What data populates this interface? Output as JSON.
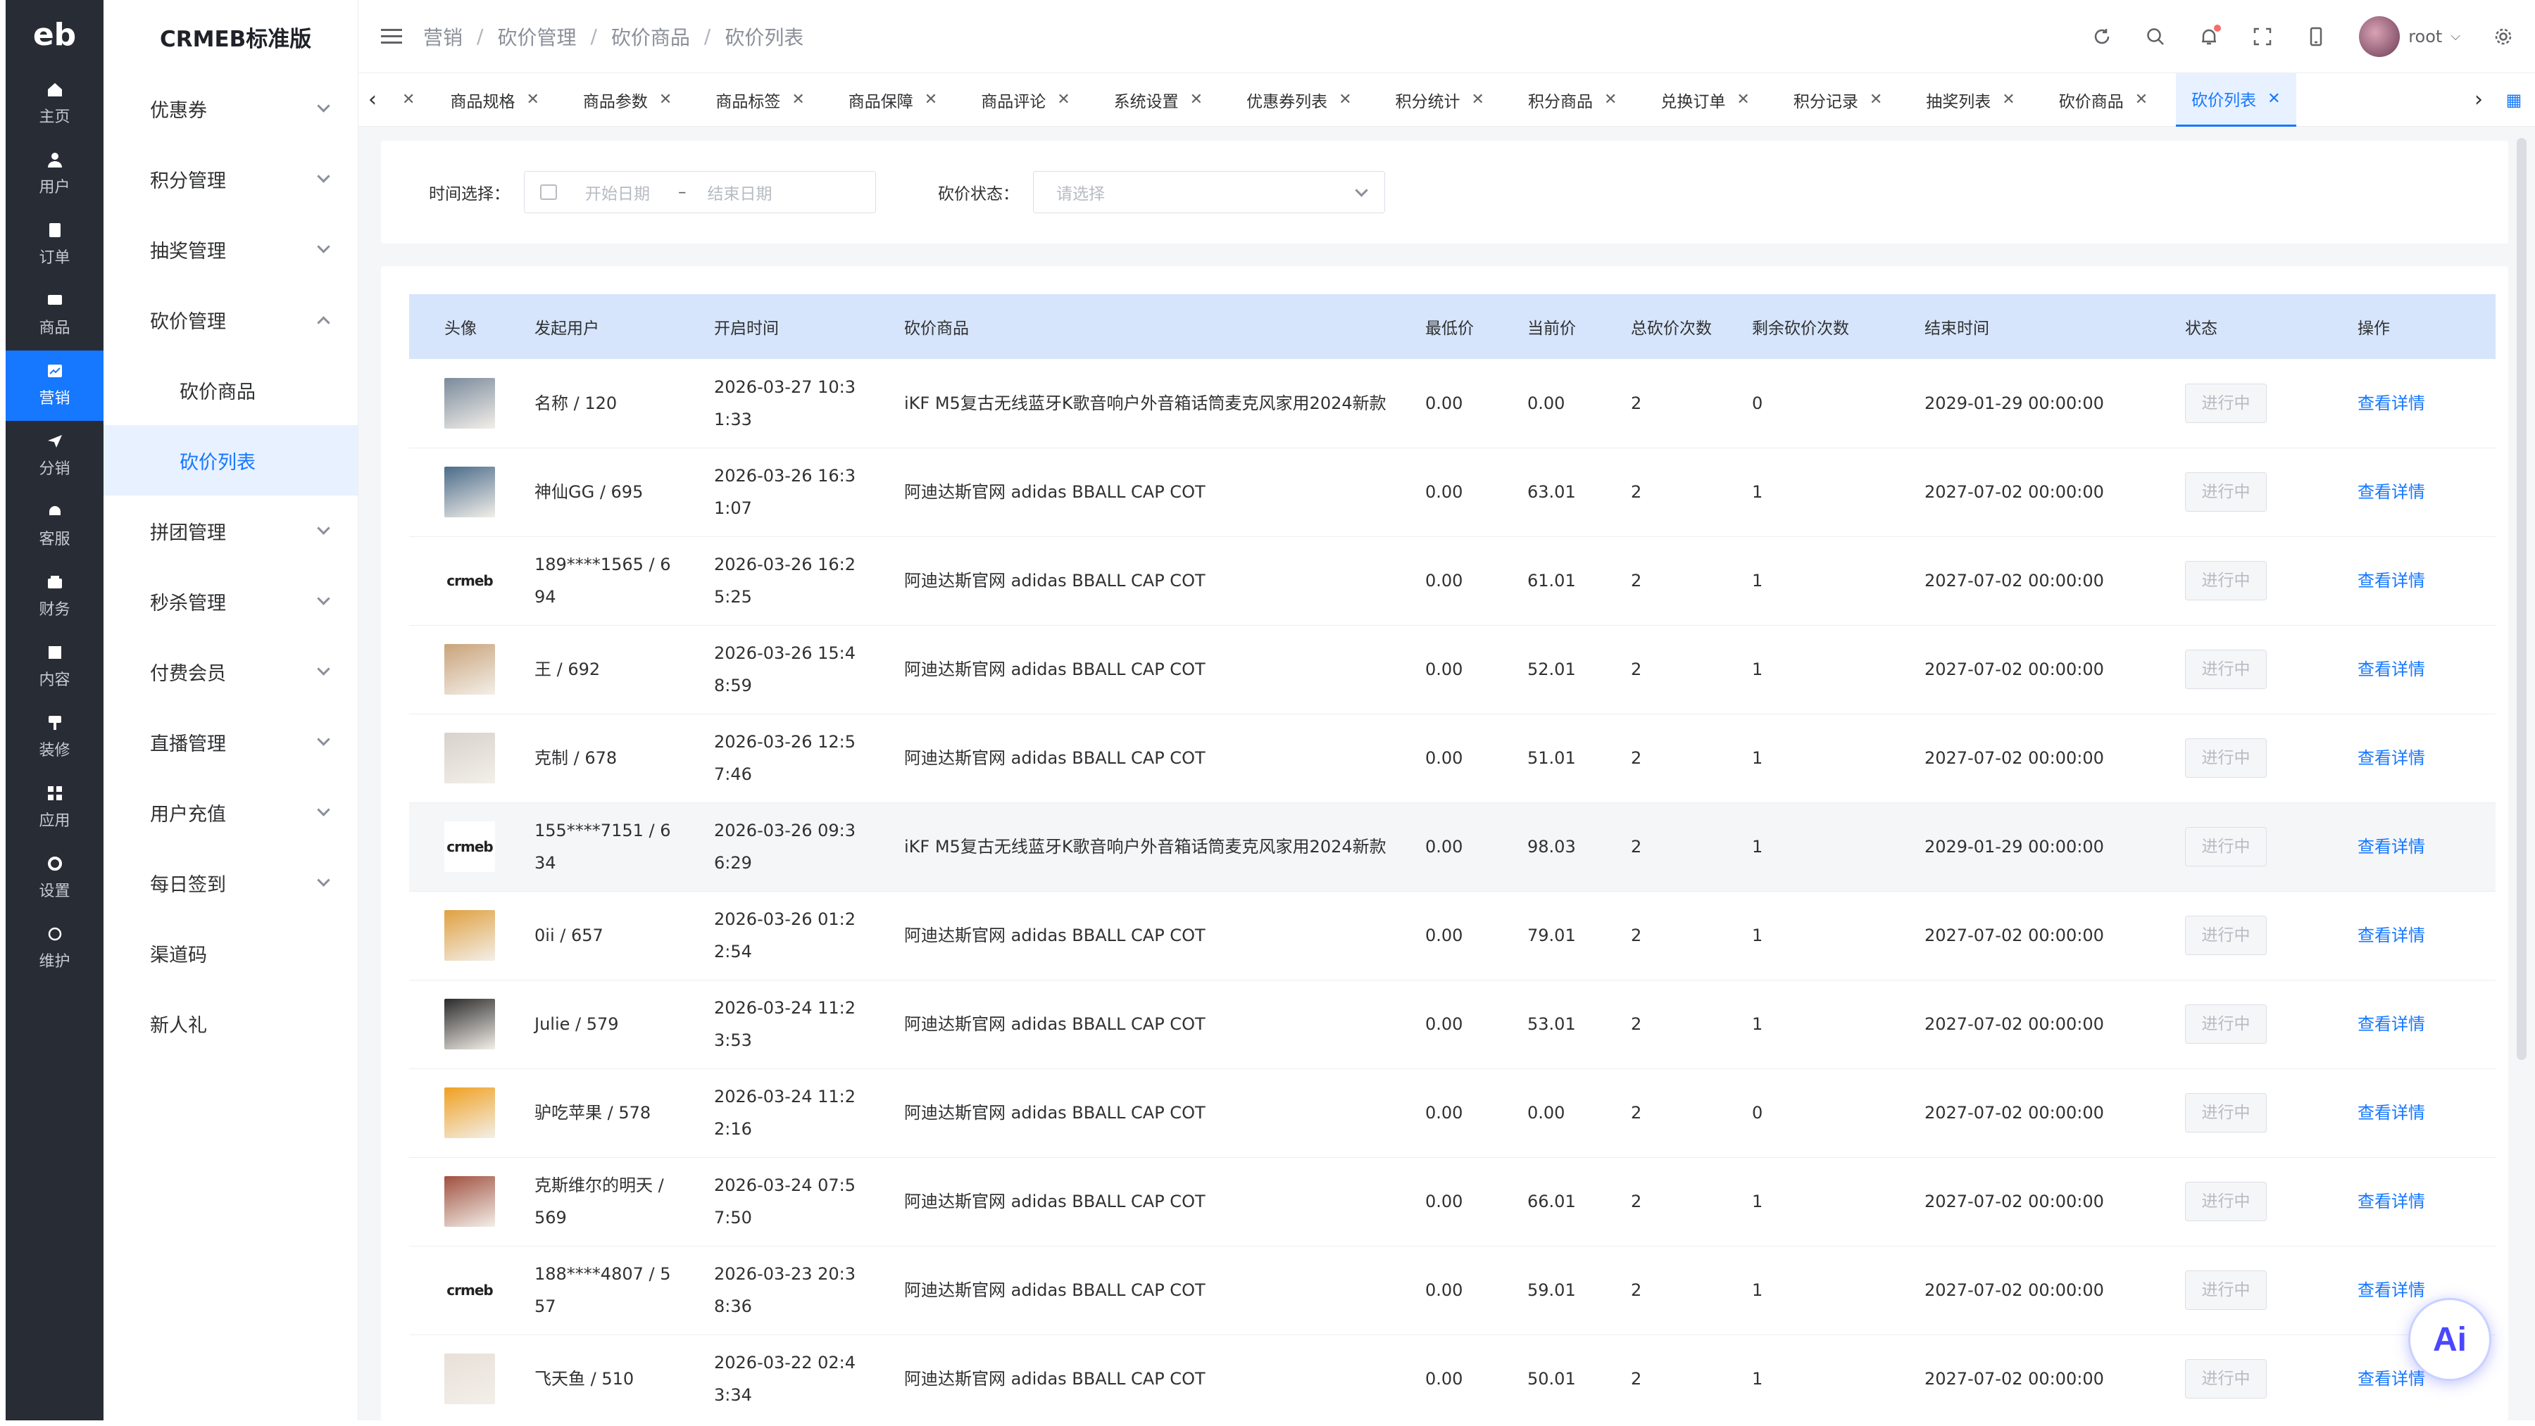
{
  "rail": {
    "logo": "eb",
    "items": [
      {
        "label": "主页",
        "icon": "home-icon"
      },
      {
        "label": "用户",
        "icon": "user-icon"
      },
      {
        "label": "订单",
        "icon": "order-icon"
      },
      {
        "label": "商品",
        "icon": "goods-icon"
      },
      {
        "label": "营销",
        "icon": "marketing-icon",
        "active": true
      },
      {
        "label": "分销",
        "icon": "distribution-icon"
      },
      {
        "label": "客服",
        "icon": "service-icon"
      },
      {
        "label": "财务",
        "icon": "finance-icon"
      },
      {
        "label": "内容",
        "icon": "content-icon"
      },
      {
        "label": "装修",
        "icon": "decorate-icon"
      },
      {
        "label": "应用",
        "icon": "apps-icon"
      },
      {
        "label": "设置",
        "icon": "settings-icon"
      },
      {
        "label": "维护",
        "icon": "maintain-icon"
      }
    ]
  },
  "submenu": {
    "brand": "CRMEB标准版",
    "items": [
      {
        "label": "优惠券"
      },
      {
        "label": "积分管理"
      },
      {
        "label": "抽奖管理"
      },
      {
        "label": "砍价管理",
        "open": true
      },
      {
        "label": "拼团管理"
      },
      {
        "label": "秒杀管理"
      },
      {
        "label": "付费会员"
      },
      {
        "label": "直播管理"
      },
      {
        "label": "用户充值"
      },
      {
        "label": "每日签到"
      },
      {
        "label": "渠道码"
      },
      {
        "label": "新人礼"
      }
    ],
    "children": [
      "砍价商品",
      "砍价列表"
    ]
  },
  "header": {
    "breadcrumb": [
      "营销",
      "砍价管理",
      "砍价商品",
      "砍价列表"
    ],
    "username": "root"
  },
  "tabs": [
    "商品规格",
    "商品参数",
    "商品标签",
    "商品保障",
    "商品评论",
    "系统设置",
    "优惠券列表",
    "积分统计",
    "积分商品",
    "兑换订单",
    "积分记录",
    "抽奖列表",
    "砍价商品",
    "砍价列表"
  ],
  "filters": {
    "time_label": "时间选择：",
    "start_placeholder": "开始日期",
    "end_placeholder": "结束日期",
    "range_sep": "–",
    "status_label": "砍价状态：",
    "status_placeholder": "请选择"
  },
  "table": {
    "columns": [
      "头像",
      "发起用户",
      "开启时间",
      "砍价商品",
      "最低价",
      "当前价",
      "总砍价次数",
      "剩余砍价次数",
      "结束时间",
      "状态",
      "操作"
    ],
    "rows": [
      {
        "avatar": "photo",
        "user": "名称 / 120",
        "start": "2026-03-27 10:31:33",
        "product": "iKF M5复古无线蓝牙K歌音响户外音箱话筒麦克风家用2024新款",
        "min": "0.00",
        "cur": "0.00",
        "total": "2",
        "remain": "0",
        "end": "2029-01-29 00:00:00",
        "status": "进行中",
        "action": "查看详情"
      },
      {
        "avatar": "photo",
        "user": "神仙GG / 695",
        "start": "2026-03-26 16:31:07",
        "product": "阿迪达斯官网 adidas BBALL CAP COT",
        "min": "0.00",
        "cur": "63.01",
        "total": "2",
        "remain": "1",
        "end": "2027-07-02 00:00:00",
        "status": "进行中",
        "action": "查看详情"
      },
      {
        "avatar": "logo",
        "user": "189****1565 / 694",
        "start": "2026-03-26 16:25:25",
        "product": "阿迪达斯官网 adidas BBALL CAP COT",
        "min": "0.00",
        "cur": "61.01",
        "total": "2",
        "remain": "1",
        "end": "2027-07-02 00:00:00",
        "status": "进行中",
        "action": "查看详情"
      },
      {
        "avatar": "photo",
        "user": "王 / 692",
        "start": "2026-03-26 15:48:59",
        "product": "阿迪达斯官网 adidas BBALL CAP COT",
        "min": "0.00",
        "cur": "52.01",
        "total": "2",
        "remain": "1",
        "end": "2027-07-02 00:00:00",
        "status": "进行中",
        "action": "查看详情"
      },
      {
        "avatar": "photo",
        "user": "克制 / 678",
        "start": "2026-03-26 12:57:46",
        "product": "阿迪达斯官网 adidas BBALL CAP COT",
        "min": "0.00",
        "cur": "51.01",
        "total": "2",
        "remain": "1",
        "end": "2027-07-02 00:00:00",
        "status": "进行中",
        "action": "查看详情"
      },
      {
        "avatar": "logo",
        "user": "155****7151 / 634",
        "start": "2026-03-26 09:36:29",
        "product": "iKF M5复古无线蓝牙K歌音响户外音箱话筒麦克风家用2024新款",
        "min": "0.00",
        "cur": "98.03",
        "total": "2",
        "remain": "1",
        "end": "2029-01-29 00:00:00",
        "status": "进行中",
        "action": "查看详情"
      },
      {
        "avatar": "photo",
        "user": "0ii / 657",
        "start": "2026-03-26 01:22:54",
        "product": "阿迪达斯官网 adidas BBALL CAP COT",
        "min": "0.00",
        "cur": "79.01",
        "total": "2",
        "remain": "1",
        "end": "2027-07-02 00:00:00",
        "status": "进行中",
        "action": "查看详情"
      },
      {
        "avatar": "photo",
        "user": "Julie / 579",
        "start": "2026-03-24 11:23:53",
        "product": "阿迪达斯官网 adidas BBALL CAP COT",
        "min": "0.00",
        "cur": "53.01",
        "total": "2",
        "remain": "1",
        "end": "2027-07-02 00:00:00",
        "status": "进行中",
        "action": "查看详情"
      },
      {
        "avatar": "photo",
        "user": "驴吃苹果 / 578",
        "start": "2026-03-24 11:22:16",
        "product": "阿迪达斯官网 adidas BBALL CAP COT",
        "min": "0.00",
        "cur": "0.00",
        "total": "2",
        "remain": "0",
        "end": "2027-07-02 00:00:00",
        "status": "进行中",
        "action": "查看详情"
      },
      {
        "avatar": "photo",
        "user": "克斯维尔的明天 / 569",
        "start": "2026-03-24 07:57:50",
        "product": "阿迪达斯官网 adidas BBALL CAP COT",
        "min": "0.00",
        "cur": "66.01",
        "total": "2",
        "remain": "1",
        "end": "2027-07-02 00:00:00",
        "status": "进行中",
        "action": "查看详情"
      },
      {
        "avatar": "logo",
        "user": "188****4807 / 557",
        "start": "2026-03-23 20:38:36",
        "product": "阿迪达斯官网 adidas BBALL CAP COT",
        "min": "0.00",
        "cur": "59.01",
        "total": "2",
        "remain": "1",
        "end": "2027-07-02 00:00:00",
        "status": "进行中",
        "action": "查看详情"
      },
      {
        "avatar": "photo",
        "user": "飞天鱼 / 510",
        "start": "2026-03-22 02:43:34",
        "product": "阿迪达斯官网 adidas BBALL CAP COT",
        "min": "0.00",
        "cur": "50.01",
        "total": "2",
        "remain": "1",
        "end": "2027-07-02 00:00:00",
        "status": "进行中",
        "action": "查看详情"
      }
    ]
  },
  "logo_text": "crmeb",
  "ai_label": "Ai",
  "colors": {
    "accent": "#1677ff",
    "rail_bg": "#282c34",
    "header_row": "#d6e5fb"
  }
}
